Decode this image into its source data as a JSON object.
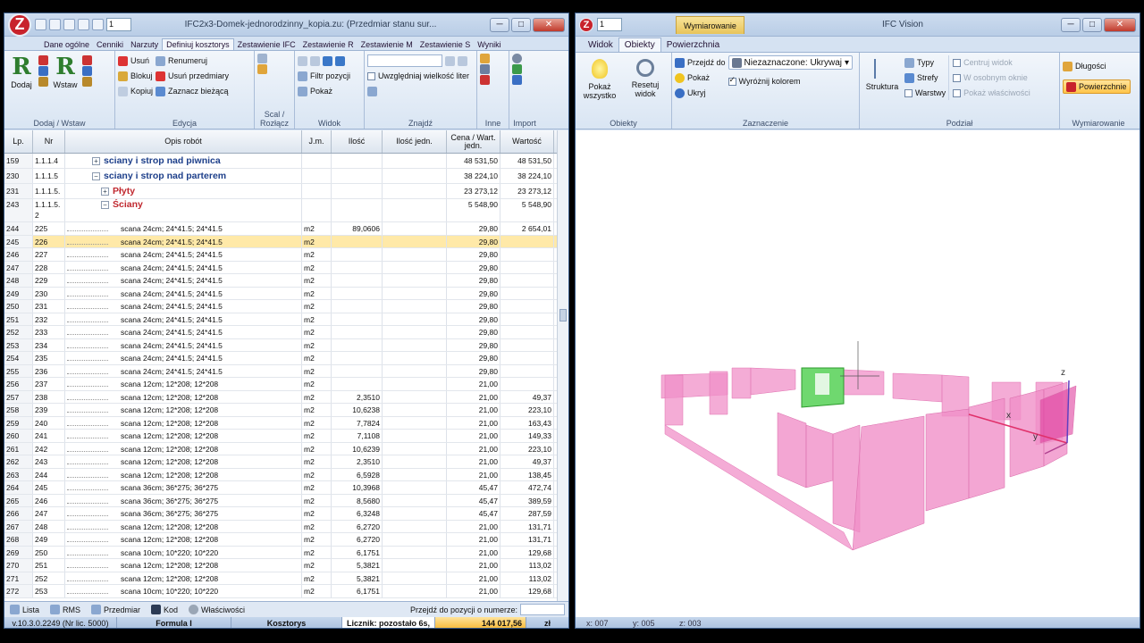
{
  "left_window": {
    "title": "IFC2x3-Domek-jednorodzinny_kopia.zu: (Przedmiar stanu sur...",
    "spinner": "1",
    "tabs": [
      "Dane ogólne",
      "Cenniki",
      "Narzuty",
      "Definiuj kosztorys",
      "Zestawienie IFC",
      "Zestawienie R",
      "Zestawienie M",
      "Zestawienie S",
      "Wyniki"
    ],
    "ribbon": {
      "dodaj": "Dodaj",
      "wstaw": "Wstaw",
      "group1": "Dodaj / Wstaw",
      "usun": "Usuń",
      "blokuj": "Blokuj",
      "kopiuj": "Kopiuj",
      "renumeruj": "Renumeruj",
      "usun_przedmiary": "Usuń przedmiary",
      "zaznacz_biezaca": "Zaznacz bieżącą",
      "group2": "Edycja",
      "group3": "Scal / Rozłącz",
      "filtr_pozycji": "Filtr pozycji",
      "pokaz": "Pokaż",
      "group4": "Widok",
      "uwzgledniaj": "Uwzględniaj wielkość liter",
      "group5": "Znajdź",
      "group6": "Inne",
      "group7": "Import"
    },
    "grid_header": {
      "lp": "Lp.",
      "nr": "Nr",
      "opis": "Opis robót",
      "jm": "J.m.",
      "ilosc": "Ilość",
      "ilosc_jedn": "Ilość jedn.",
      "cena": "Cena / Wart. jedn.",
      "wartosc": "Wartość"
    },
    "rows": [
      {
        "lp": "159",
        "nr": "1.1.1.4",
        "opis": "sciany i strop nad piwnica",
        "jm": "",
        "il": "",
        "ilj": "",
        "cena": "48 531,50",
        "wart": "48 531,50",
        "kind": "h1",
        "tree": "+",
        "indent": 0
      },
      {
        "lp": "230",
        "nr": "1.1.1.5",
        "opis": "sciany i strop nad parterem",
        "jm": "",
        "il": "",
        "ilj": "",
        "cena": "38 224,10",
        "wart": "38 224,10",
        "kind": "h1",
        "tree": "−",
        "indent": 0
      },
      {
        "lp": "231",
        "nr": "1.1.1.5.\n1",
        "opis": "Płyty",
        "jm": "",
        "il": "",
        "ilj": "",
        "cena": "23 273,12",
        "wart": "23 273,12",
        "kind": "h2",
        "tree": "+",
        "indent": 1
      },
      {
        "lp": "243",
        "nr": "1.1.1.5.\n2",
        "opis": "Ściany",
        "jm": "",
        "il": "",
        "ilj": "",
        "cena": "5 548,90",
        "wart": "5 548,90",
        "kind": "h2b",
        "tree": "−",
        "indent": 1
      },
      {
        "lp": "244",
        "nr": "225",
        "opis": "scana 24cm; 24*41.5; 24*41.5",
        "jm": "m2",
        "il": "89,0606",
        "ilj": "",
        "cena": "29,80",
        "wart": "2 654,01",
        "kind": "n"
      },
      {
        "lp": "245",
        "nr": "226",
        "opis": "scana 24cm; 24*41.5; 24*41.5",
        "jm": "m2",
        "il": "",
        "ilj": "",
        "cena": "29,80",
        "wart": "",
        "kind": "sel"
      },
      {
        "lp": "246",
        "nr": "227",
        "opis": "scana 24cm; 24*41.5; 24*41.5",
        "jm": "m2",
        "il": "",
        "ilj": "",
        "cena": "29,80",
        "wart": "",
        "kind": "n"
      },
      {
        "lp": "247",
        "nr": "228",
        "opis": "scana 24cm; 24*41.5; 24*41.5",
        "jm": "m2",
        "il": "",
        "ilj": "",
        "cena": "29,80",
        "wart": "",
        "kind": "n"
      },
      {
        "lp": "248",
        "nr": "229",
        "opis": "scana 24cm; 24*41.5; 24*41.5",
        "jm": "m2",
        "il": "",
        "ilj": "",
        "cena": "29,80",
        "wart": "",
        "kind": "n"
      },
      {
        "lp": "249",
        "nr": "230",
        "opis": "scana 24cm; 24*41.5; 24*41.5",
        "jm": "m2",
        "il": "",
        "ilj": "",
        "cena": "29,80",
        "wart": "",
        "kind": "n"
      },
      {
        "lp": "250",
        "nr": "231",
        "opis": "scana 24cm; 24*41.5; 24*41.5",
        "jm": "m2",
        "il": "",
        "ilj": "",
        "cena": "29,80",
        "wart": "",
        "kind": "n"
      },
      {
        "lp": "251",
        "nr": "232",
        "opis": "scana 24cm; 24*41.5; 24*41.5",
        "jm": "m2",
        "il": "",
        "ilj": "",
        "cena": "29,80",
        "wart": "",
        "kind": "n"
      },
      {
        "lp": "252",
        "nr": "233",
        "opis": "scana 24cm; 24*41.5; 24*41.5",
        "jm": "m2",
        "il": "",
        "ilj": "",
        "cena": "29,80",
        "wart": "",
        "kind": "n"
      },
      {
        "lp": "253",
        "nr": "234",
        "opis": "scana 24cm; 24*41.5; 24*41.5",
        "jm": "m2",
        "il": "",
        "ilj": "",
        "cena": "29,80",
        "wart": "",
        "kind": "n"
      },
      {
        "lp": "254",
        "nr": "235",
        "opis": "scana 24cm; 24*41.5; 24*41.5",
        "jm": "m2",
        "il": "",
        "ilj": "",
        "cena": "29,80",
        "wart": "",
        "kind": "n"
      },
      {
        "lp": "255",
        "nr": "236",
        "opis": "scana 24cm; 24*41.5; 24*41.5",
        "jm": "m2",
        "il": "",
        "ilj": "",
        "cena": "29,80",
        "wart": "",
        "kind": "n"
      },
      {
        "lp": "256",
        "nr": "237",
        "opis": "scana 12cm; 12*208; 12*208",
        "jm": "m2",
        "il": "",
        "ilj": "",
        "cena": "21,00",
        "wart": "",
        "kind": "n"
      },
      {
        "lp": "257",
        "nr": "238",
        "opis": "scana 12cm; 12*208; 12*208",
        "jm": "m2",
        "il": "2,3510",
        "ilj": "",
        "cena": "21,00",
        "wart": "49,37",
        "kind": "n"
      },
      {
        "lp": "258",
        "nr": "239",
        "opis": "scana 12cm; 12*208; 12*208",
        "jm": "m2",
        "il": "10,6238",
        "ilj": "",
        "cena": "21,00",
        "wart": "223,10",
        "kind": "n"
      },
      {
        "lp": "259",
        "nr": "240",
        "opis": "scana 12cm; 12*208; 12*208",
        "jm": "m2",
        "il": "7,7824",
        "ilj": "",
        "cena": "21,00",
        "wart": "163,43",
        "kind": "n"
      },
      {
        "lp": "260",
        "nr": "241",
        "opis": "scana 12cm; 12*208; 12*208",
        "jm": "m2",
        "il": "7,1108",
        "ilj": "",
        "cena": "21,00",
        "wart": "149,33",
        "kind": "n"
      },
      {
        "lp": "261",
        "nr": "242",
        "opis": "scana 12cm; 12*208; 12*208",
        "jm": "m2",
        "il": "10,6239",
        "ilj": "",
        "cena": "21,00",
        "wart": "223,10",
        "kind": "n"
      },
      {
        "lp": "262",
        "nr": "243",
        "opis": "scana 12cm; 12*208; 12*208",
        "jm": "m2",
        "il": "2,3510",
        "ilj": "",
        "cena": "21,00",
        "wart": "49,37",
        "kind": "n"
      },
      {
        "lp": "263",
        "nr": "244",
        "opis": "scana 12cm; 12*208; 12*208",
        "jm": "m2",
        "il": "6,5928",
        "ilj": "",
        "cena": "21,00",
        "wart": "138,45",
        "kind": "n"
      },
      {
        "lp": "264",
        "nr": "245",
        "opis": "scana 36cm; 36*275; 36*275",
        "jm": "m2",
        "il": "10,3968",
        "ilj": "",
        "cena": "45,47",
        "wart": "472,74",
        "kind": "n"
      },
      {
        "lp": "265",
        "nr": "246",
        "opis": "scana 36cm; 36*275; 36*275",
        "jm": "m2",
        "il": "8,5680",
        "ilj": "",
        "cena": "45,47",
        "wart": "389,59",
        "kind": "n"
      },
      {
        "lp": "266",
        "nr": "247",
        "opis": "scana 36cm; 36*275; 36*275",
        "jm": "m2",
        "il": "6,3248",
        "ilj": "",
        "cena": "45,47",
        "wart": "287,59",
        "kind": "n"
      },
      {
        "lp": "267",
        "nr": "248",
        "opis": "scana 12cm; 12*208; 12*208",
        "jm": "m2",
        "il": "6,2720",
        "ilj": "",
        "cena": "21,00",
        "wart": "131,71",
        "kind": "n"
      },
      {
        "lp": "268",
        "nr": "249",
        "opis": "scana 12cm; 12*208; 12*208",
        "jm": "m2",
        "il": "6,2720",
        "ilj": "",
        "cena": "21,00",
        "wart": "131,71",
        "kind": "n"
      },
      {
        "lp": "269",
        "nr": "250",
        "opis": "scana 10cm; 10*220; 10*220",
        "jm": "m2",
        "il": "6,1751",
        "ilj": "",
        "cena": "21,00",
        "wart": "129,68",
        "kind": "n"
      },
      {
        "lp": "270",
        "nr": "251",
        "opis": "scana 12cm; 12*208; 12*208",
        "jm": "m2",
        "il": "5,3821",
        "ilj": "",
        "cena": "21,00",
        "wart": "113,02",
        "kind": "n"
      },
      {
        "lp": "271",
        "nr": "252",
        "opis": "scana 12cm; 12*208; 12*208",
        "jm": "m2",
        "il": "5,3821",
        "ilj": "",
        "cena": "21,00",
        "wart": "113,02",
        "kind": "n"
      },
      {
        "lp": "272",
        "nr": "253",
        "opis": "scana 10cm; 10*220; 10*220",
        "jm": "m2",
        "il": "6,1751",
        "ilj": "",
        "cena": "21,00",
        "wart": "129,68",
        "kind": "n"
      }
    ],
    "bottom_tabs": [
      "Lista",
      "RMS",
      "Przedmiar",
      "Kod",
      "Właściwości"
    ],
    "goto_label": "Przejdź do pozycji o numerze:",
    "status": {
      "version": "v.10.3.0.2249 (Nr lic. 5000)",
      "formula": "Formula I",
      "kosztorys": "Kosztorys",
      "licznik": "Licznik: pozostało 6s,",
      "total": "144 017,56",
      "currency": "zł"
    }
  },
  "right_window": {
    "title": "IFC Vision",
    "context_tab": "Wymiarowanie",
    "spinner": "1",
    "tabs": [
      "Widok",
      "Obiekty",
      "Powierzchnia"
    ],
    "ribbon": {
      "pokaz_wszystko": "Pokaż wszystko",
      "resetuj_widok": "Resetuj widok",
      "group1": "Obiekty",
      "przejdz_do": "Przejdź do",
      "pokaz": "Pokaż",
      "ukryj": "Ukryj",
      "niezaznaczone": "Niezaznaczone: Ukrywaj",
      "wyroznij": "Wyróżnij kolorem",
      "group2": "Zaznaczenie",
      "struktura": "Struktura",
      "typy": "Typy",
      "strefy": "Strefy",
      "warstwy": "Warstwy",
      "centruj": "Centruj widok",
      "osobnym": "W osobnym oknie",
      "pokaz_wl": "Pokaż właściwości",
      "group3": "Podział",
      "dlugosci": "Długości",
      "powierzchnie": "Powierzchnie",
      "group4": "Wymiarowanie"
    },
    "axes": {
      "x": "x",
      "y": "y",
      "z": "z"
    },
    "status": [
      "x: 007",
      "y: 005",
      "z: 003"
    ]
  },
  "colors": {
    "wall": "#f090c8",
    "selected": "#6fd86f",
    "accent": "#ffc54a"
  }
}
